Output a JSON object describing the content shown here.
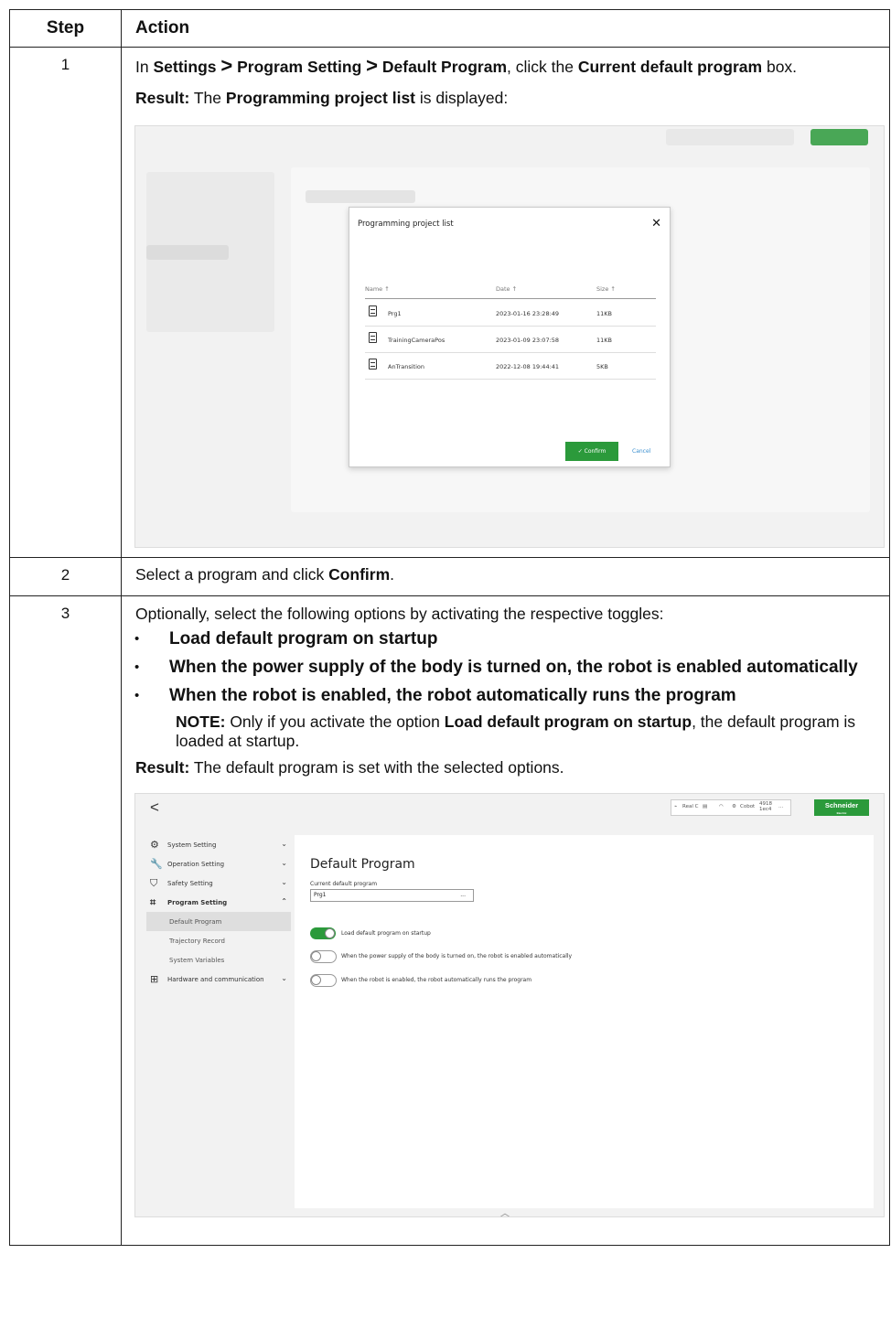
{
  "table": {
    "header_step": "Step",
    "header_action": "Action"
  },
  "row1": {
    "step": "1",
    "line1_pre": "In ",
    "line1_settings": "Settings",
    "sep1": ">",
    "line1_program_setting": "Program Setting",
    "sep2": ">",
    "line1_default_program": "Default Program",
    "line1_mid": ", click the ",
    "line1_current": "Current default program",
    "line1_post": " box.",
    "result_label": "Result:",
    "result_pre": " The ",
    "result_bold": "Programming project list",
    "result_post": " is displayed:"
  },
  "dialog": {
    "title": "Programming project list",
    "close_icon": "close-icon",
    "col_name": "Name ↑",
    "col_date": "Date ↑",
    "col_size": "Size ↑",
    "rows": [
      {
        "name": "Prg1",
        "date": "2023-01-16 23:28:49",
        "size": "11KB"
      },
      {
        "name": "TrainingCameraPos",
        "date": "2023-01-09 23:07:58",
        "size": "11KB"
      },
      {
        "name": "AnTransition",
        "date": "2022-12-08 19:44:41",
        "size": "5KB"
      }
    ],
    "confirm": "✓ Confirm",
    "cancel": "Cancel"
  },
  "row2": {
    "step": "2",
    "pre": "Select a program and click ",
    "bold": "Confirm",
    "post": "."
  },
  "row3": {
    "step": "3",
    "intro": "Optionally, select the following options by activating the respective toggles:",
    "options": [
      "Load default program on startup",
      "When the power supply of the body is turned on, the robot is enabled automatically",
      "When the robot is enabled, the robot automatically runs the program"
    ],
    "note_label": "NOTE:",
    "note_pre": " Only if you activate the option ",
    "note_bold": "Load default program on startup",
    "note_post": ", the default program is loaded at startup.",
    "result_label": "Result:",
    "result_text": " The default program is set with the selected options."
  },
  "app": {
    "back_icon": "chevron-left-icon",
    "status_real": "Real C",
    "status_cobot": "Cobot",
    "status_id1": "4918",
    "status_id2": "1ec4",
    "status_more": "...",
    "brand": "Schneider",
    "brand_sub": "Electric",
    "sidebar": [
      {
        "label": "System Setting",
        "icon": "gear-icon",
        "chevron": "⌄"
      },
      {
        "label": "Operation Setting",
        "icon": "wrench-icon",
        "chevron": "⌄"
      },
      {
        "label": "Safety Setting",
        "icon": "shield-icon",
        "chevron": "⌄"
      },
      {
        "label": "Program Setting",
        "icon": "program-icon",
        "chevron": "⌃"
      },
      {
        "label": "Hardware and communication",
        "icon": "network-icon",
        "chevron": "⌄"
      }
    ],
    "subitems": [
      "Default Program",
      "Trajectory Record",
      "System Variables"
    ],
    "page_title": "Default Program",
    "field_label": "Current default program",
    "field_value": "Prg1",
    "field_dots": "...",
    "toggles": [
      {
        "label": "Load default program on startup",
        "on": true
      },
      {
        "label": "When the power supply of the body is turned on, the robot is enabled automatically",
        "on": false
      },
      {
        "label": "When the robot is enabled, the robot automatically runs the program",
        "on": false
      }
    ]
  }
}
